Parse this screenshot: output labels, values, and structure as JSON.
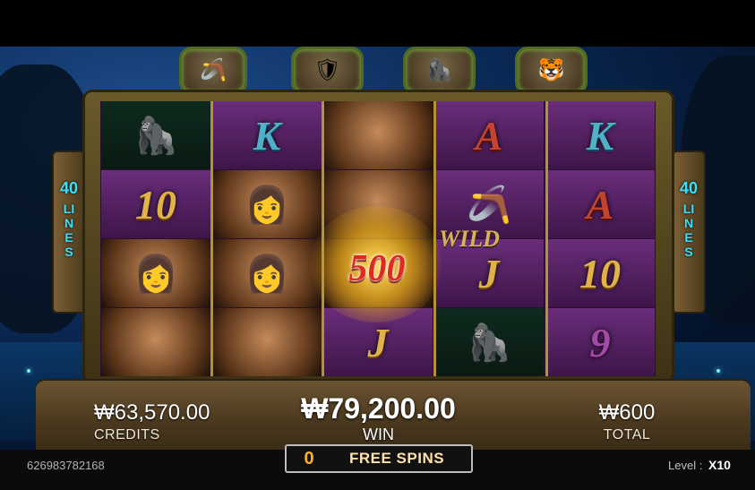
{
  "header": {
    "icons": [
      "boomerang-icon",
      "shield-icon",
      "gorilla-icon",
      "tiger-icon"
    ]
  },
  "side": {
    "lines_count": "40",
    "lines_word": "LINES"
  },
  "reels": {
    "columns": [
      [
        {
          "type": "icon",
          "name": "gorilla-symbol",
          "glyph": "🦍"
        },
        {
          "type": "letter",
          "text": "10",
          "style": "gold"
        },
        {
          "type": "icon",
          "name": "woman-symbol",
          "glyph": "👩"
        },
        {
          "type": "icon",
          "name": "woman-body-symbol",
          "glyph": ""
        }
      ],
      [
        {
          "type": "letter",
          "text": "K",
          "style": "teal"
        },
        {
          "type": "icon",
          "name": "woman-symbol",
          "glyph": "👩"
        },
        {
          "type": "icon",
          "name": "woman-symbol",
          "glyph": "👩"
        },
        {
          "type": "icon",
          "name": "woman-body-symbol",
          "glyph": ""
        }
      ],
      [
        {
          "type": "icon",
          "name": "woman-body-symbol",
          "glyph": ""
        },
        {
          "type": "icon",
          "name": "woman-body-symbol",
          "glyph": ""
        },
        {
          "type": "icon",
          "name": "woman-body-symbol",
          "glyph": ""
        },
        {
          "type": "letter",
          "text": "J",
          "style": "gold"
        }
      ],
      [
        {
          "type": "letter",
          "text": "A",
          "style": "red"
        },
        {
          "type": "icon",
          "name": "boomerang-symbol",
          "glyph": "🪃"
        },
        {
          "type": "letter",
          "text": "J",
          "style": "gold"
        },
        {
          "type": "icon",
          "name": "gorilla-symbol",
          "glyph": "🦍"
        }
      ],
      [
        {
          "type": "letter",
          "text": "K",
          "style": "teal"
        },
        {
          "type": "letter",
          "text": "A",
          "style": "red"
        },
        {
          "type": "letter",
          "text": "10",
          "style": "gold"
        },
        {
          "type": "letter",
          "text": "9",
          "style": "purp"
        }
      ]
    ],
    "wild_label": "WILD",
    "win_amount": "500"
  },
  "panel": {
    "credits_amount": "₩63,570.00",
    "credits_label": "CREDITS",
    "win_amount": "₩79,200.00",
    "win_label": "WIN",
    "total_amount": "₩600",
    "total_label": "TOTAL"
  },
  "status": {
    "round_id": "626983782168",
    "free_spins_count": "0",
    "free_spins_label": "FREE SPINS",
    "level_label": "Level :",
    "level_value": "X10"
  }
}
